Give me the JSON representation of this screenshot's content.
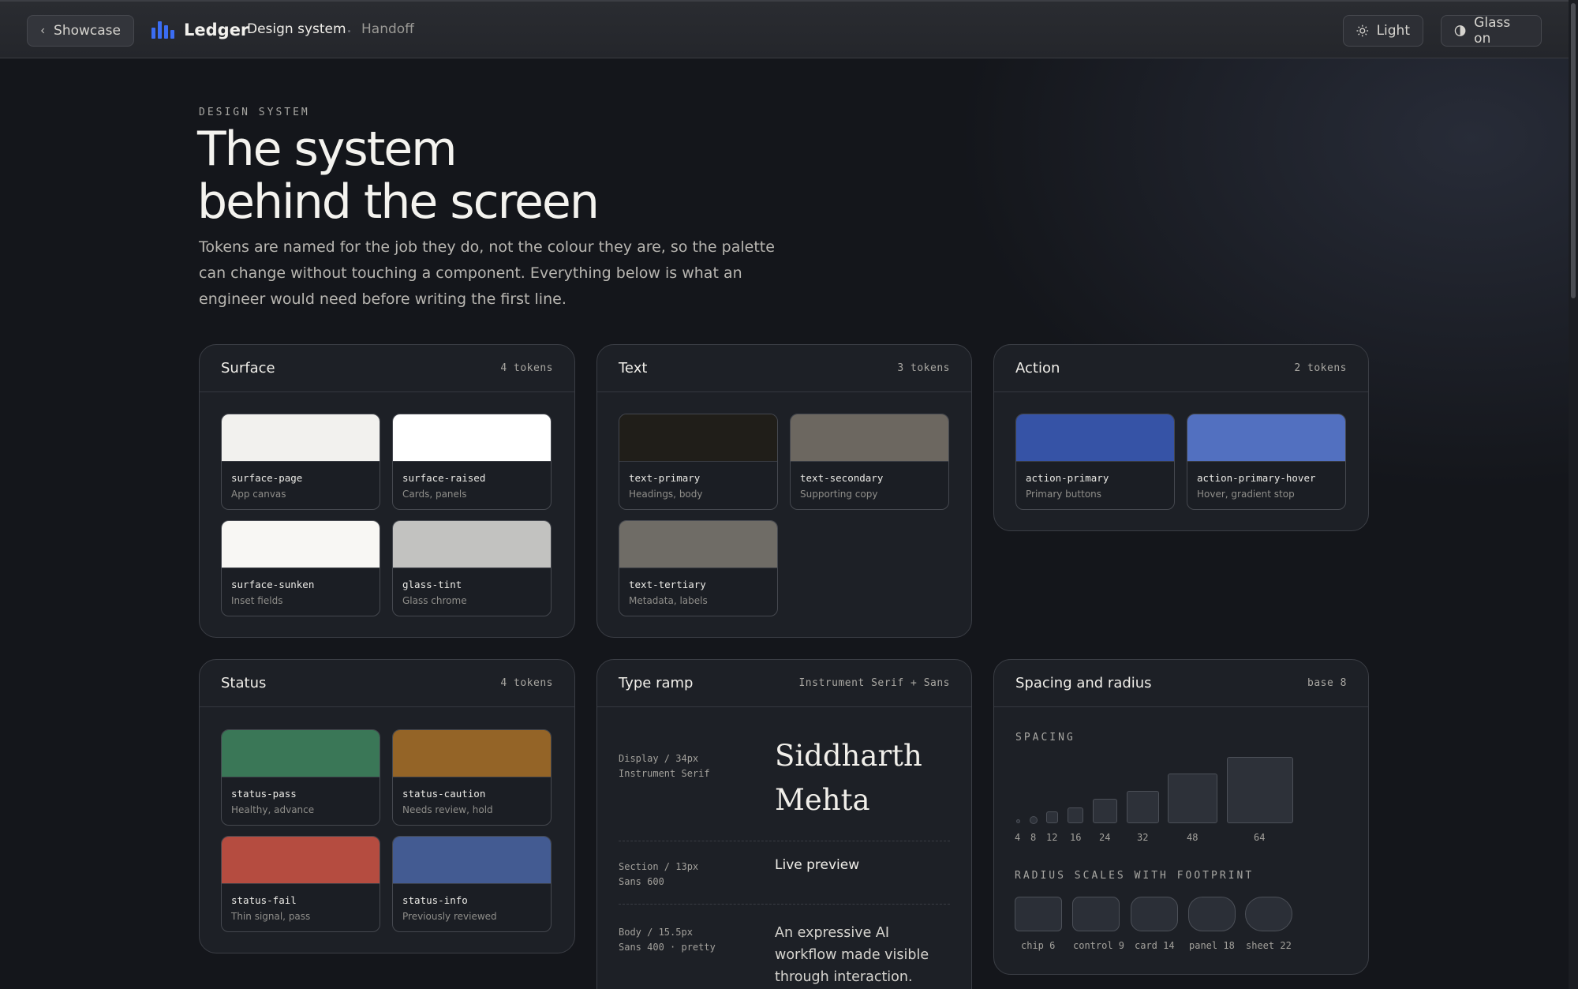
{
  "topbar": {
    "back_label": "Showcase",
    "brand": "Ledger",
    "nav": [
      "Design system",
      "Handoff"
    ],
    "theme_label": "Light",
    "glass_label": "Glass on",
    "accent": "#3b6df2"
  },
  "hero": {
    "eyebrow": "DESIGN SYSTEM",
    "title_line1": "The system",
    "title_line2": "behind the screen",
    "lede": "Tokens are named for the job they do, not the colour they are, so the palette can change without touching a component. Everything below is what an engineer would need before writing the first line."
  },
  "surface": {
    "title": "Surface",
    "meta": "4 tokens",
    "tokens": [
      {
        "name": "surface-page",
        "desc": "App canvas",
        "color": "#f2f1ee"
      },
      {
        "name": "surface-raised",
        "desc": "Cards, panels",
        "color": "#ffffff"
      },
      {
        "name": "surface-sunken",
        "desc": "Inset fields",
        "color": "#f8f7f4"
      },
      {
        "name": "glass-tint",
        "desc": "Glass chrome",
        "color": "#c2c2c0"
      }
    ]
  },
  "text": {
    "title": "Text",
    "meta": "3 tokens",
    "tokens": [
      {
        "name": "text-primary",
        "desc": "Headings, body",
        "color": "#201e19"
      },
      {
        "name": "text-secondary",
        "desc": "Supporting copy",
        "color": "#6c6760"
      },
      {
        "name": "text-tertiary",
        "desc": "Metadata, labels",
        "color": "#6f6c66"
      }
    ]
  },
  "action": {
    "title": "Action",
    "meta": "2 tokens",
    "tokens": [
      {
        "name": "action-primary",
        "desc": "Primary buttons",
        "color": "#3653a6"
      },
      {
        "name": "action-primary-hover",
        "desc": "Hover, gradient stop",
        "color": "#5270c0"
      }
    ]
  },
  "status": {
    "title": "Status",
    "meta": "4 tokens",
    "tokens": [
      {
        "name": "status-pass",
        "desc": "Healthy, advance",
        "color": "#3a7757"
      },
      {
        "name": "status-caution",
        "desc": "Needs review, hold",
        "color": "#946427"
      },
      {
        "name": "status-fail",
        "desc": "Thin signal, pass",
        "color": "#b54c40"
      },
      {
        "name": "status-info",
        "desc": "Previously reviewed",
        "color": "#435b92"
      }
    ]
  },
  "type_ramp": {
    "title": "Type ramp",
    "meta": "Instrument Serif + Sans",
    "rows": [
      {
        "label1": "Display / 34px",
        "label2": "Instrument Serif",
        "sample_line1": "Siddharth",
        "sample_line2": "Mehta"
      },
      {
        "label1": "Section / 13px",
        "label2": "Sans 600",
        "sample": "Live preview"
      },
      {
        "label1": "Body / 15.5px",
        "label2": "Sans 400 · pretty",
        "sample": "An expressive AI workflow made visible through interaction."
      }
    ]
  },
  "spacing": {
    "title": "Spacing and radius",
    "meta": "base 8",
    "spacing_label": "SPACING",
    "steps": [
      "4",
      "8",
      "12",
      "16",
      "24",
      "32",
      "48",
      "64"
    ],
    "radius_label": "RADIUS SCALES WITH FOOTPRINT",
    "radii": [
      {
        "label": "chip 6"
      },
      {
        "label": "control 9"
      },
      {
        "label": "card 14"
      },
      {
        "label": "panel 18"
      },
      {
        "label": "sheet 22"
      }
    ]
  }
}
